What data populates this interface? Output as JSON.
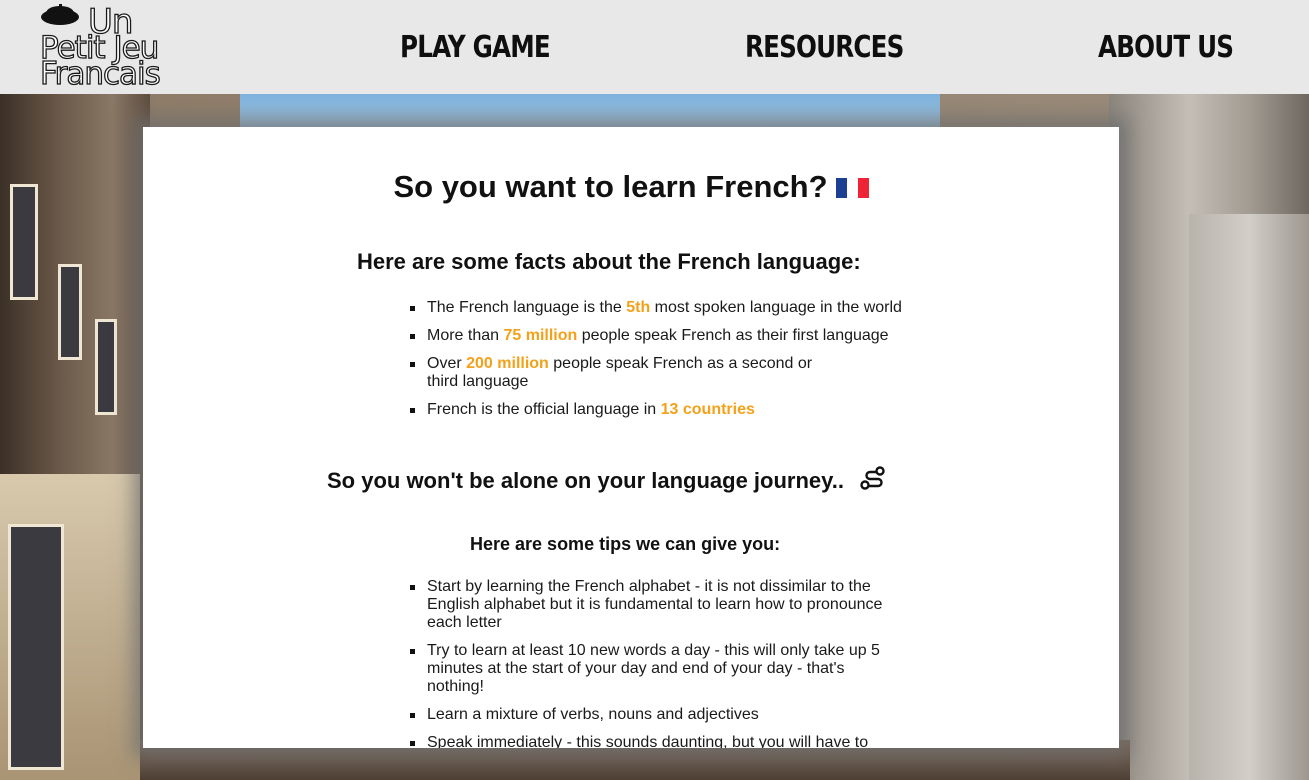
{
  "header": {
    "logo": {
      "line1": "Un",
      "line2": "Petit Jeu",
      "line3": "Francais",
      "icon": "beret-icon"
    },
    "nav": [
      {
        "label": "PLAY GAME"
      },
      {
        "label": "RESOURCES"
      },
      {
        "label": "ABOUT US"
      }
    ]
  },
  "main": {
    "title": "So you want to learn French?",
    "title_icon": "french-flag-icon",
    "flag_colors": [
      "#1c3f94",
      "#ffffff",
      "#ee2436"
    ],
    "facts_heading": "Here are some facts about the French language:",
    "facts": [
      {
        "before": "The French language is the ",
        "highlight": "5th",
        "after": " most spoken language in the world"
      },
      {
        "before": "More than ",
        "highlight": "75 million",
        "after": " people speak French as their first language"
      },
      {
        "before": "Over ",
        "highlight": "200 million",
        "after": " people speak French as a second or third language"
      },
      {
        "before": "French is the official language in ",
        "highlight": "13 countries",
        "after": ""
      }
    ],
    "journey_heading": "So you won't be alone on your language journey..",
    "journey_icon": "route-icon",
    "tips_heading": "Here are some tips we can give you:",
    "tips": [
      "Start by learning the French alphabet - it is not dissimilar to the English alphabet but it is fundamental to learn how to pronounce each letter",
      "Try to learn at least 10 new words a day - this will only take up 5 minutes at the start of your day and end of your day - that's nothing!",
      "Learn a mixture of verbs, nouns and adjectives",
      "Speak immediately - this sounds daunting, but you will have to start speaking at some point. Give yourself a headstart by talking as soon"
    ],
    "highlight_color": "#f4a11a"
  }
}
